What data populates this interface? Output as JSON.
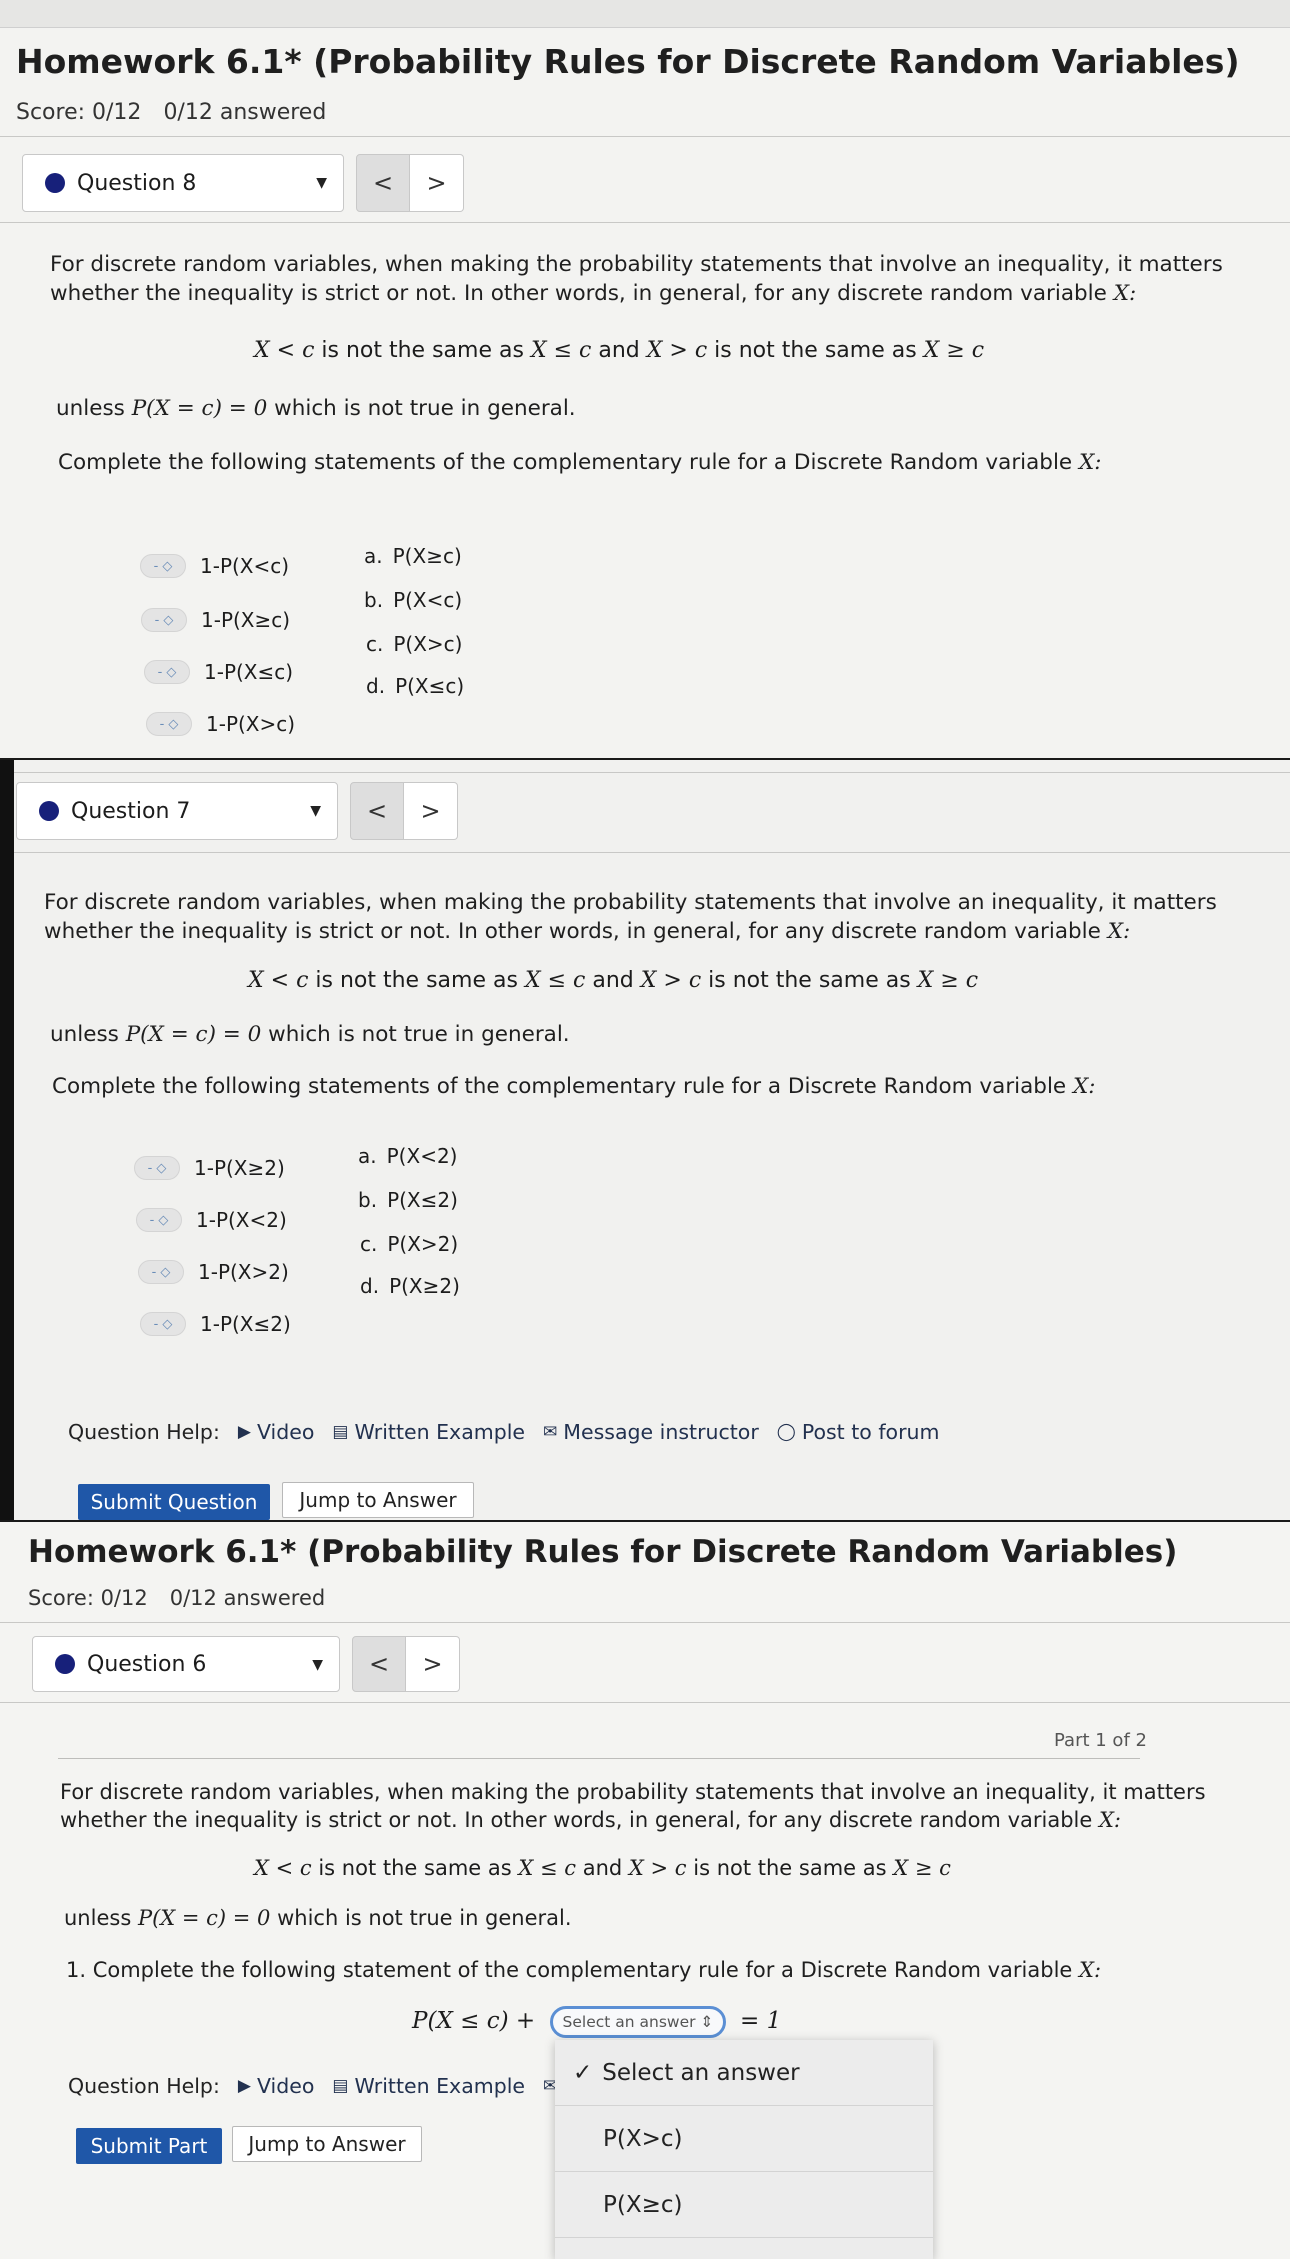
{
  "assignment": {
    "title": "Homework 6.1* (Probability Rules for Discrete Random Variables)",
    "score": "Score: 0/12",
    "answered": "0/12 answered"
  },
  "intro": {
    "line1": "For discrete random variables, when making the probability statements that involve an inequality, it matters",
    "line2": "whether the inequality is strict or not. In other words, in general, for any discrete random variable ",
    "var": "X:",
    "eq_a": "X < c",
    "not_same_1": " is not the same as ",
    "eq_b": "X ≤ c",
    "and": " and ",
    "eq_c": "X > c",
    "not_same_2": " is not the same as ",
    "eq_d": "X ≥ c",
    "unless": "unless ",
    "unless_eq": "P(X = c) = 0",
    "unless_rest": " which is not true in general.",
    "complete_plural": "Complete the following statements of the complementary rule for a Discrete Random variable ",
    "complete_single": "1. Complete the following statement of the complementary rule for a Discrete Random variable "
  },
  "question8": {
    "selector_label": "Question 8",
    "prev_icon": "chevron-left-icon",
    "next_icon": "chevron-right-icon",
    "prompts": [
      "1-P(X<c)",
      "1-P(X≥c)",
      "1-P(X≤c)",
      "1-P(X>c)"
    ],
    "options": [
      {
        "letter": "a.",
        "text": "P(X≥c)"
      },
      {
        "letter": "b.",
        "text": "P(X<c)"
      },
      {
        "letter": "c.",
        "text": "P(X>c)"
      },
      {
        "letter": "d.",
        "text": "P(X≤c)"
      }
    ]
  },
  "question7": {
    "selector_label": "Question 7",
    "prompts": [
      "1-P(X≥2)",
      "1-P(X<2)",
      "1-P(X>2)",
      "1-P(X≤2)"
    ],
    "options": [
      {
        "letter": "a.",
        "text": "P(X<2)"
      },
      {
        "letter": "b.",
        "text": "P(X≤2)"
      },
      {
        "letter": "c.",
        "text": "P(X>2)"
      },
      {
        "letter": "d.",
        "text": "P(X≥2)"
      }
    ],
    "help": {
      "label": "Question Help:",
      "video": "Video",
      "written_example": "Written Example",
      "message": "Message instructor",
      "forum": "Post to forum"
    },
    "submit": "Submit Question",
    "jump": "Jump to Answer"
  },
  "question6": {
    "selector_label": "Question 6",
    "part": "Part 1 of 2",
    "equation_left": "P(X ≤ c) +",
    "equation_right": "= 1",
    "select_placeholder": "Select an answer",
    "help_label": "Question Help:",
    "video": "Video",
    "written_example": "Written Example",
    "submit": "Submit Part",
    "jump": "Jump to Answer",
    "dropdown": [
      "Select an answer",
      "P(X>c)",
      "P(X≥c)"
    ]
  },
  "icons": {
    "video": "▶",
    "written": "▤",
    "message": "✉",
    "forum": "◯",
    "check": "✓",
    "updown": "⇕"
  },
  "colors": {
    "primary_button": "#1f57a8",
    "question_dot": "#17207a",
    "select_outline": "#5b8fd4"
  }
}
